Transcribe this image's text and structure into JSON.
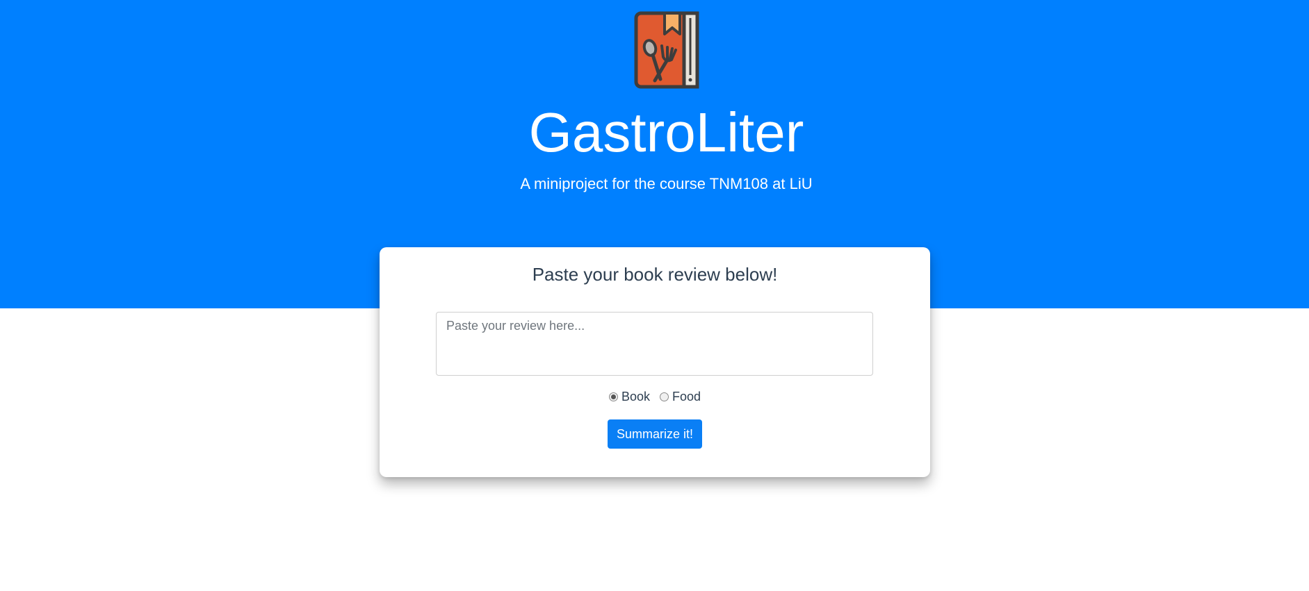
{
  "header": {
    "title": "GastroLiter",
    "subtitle": "A miniproject for the course TNM108 at LiU",
    "background_color": "#0080ff",
    "logo_icon": "book-with-spoon-and-fork-icon"
  },
  "card": {
    "title": "Paste your book review below!",
    "review_input": {
      "value": "",
      "placeholder": "Paste your review here..."
    },
    "options": [
      {
        "label": "Book",
        "checked": true
      },
      {
        "label": "Food",
        "checked": false
      }
    ],
    "submit_label": "Summarize it!",
    "accent_color": "#0a7ff5"
  }
}
